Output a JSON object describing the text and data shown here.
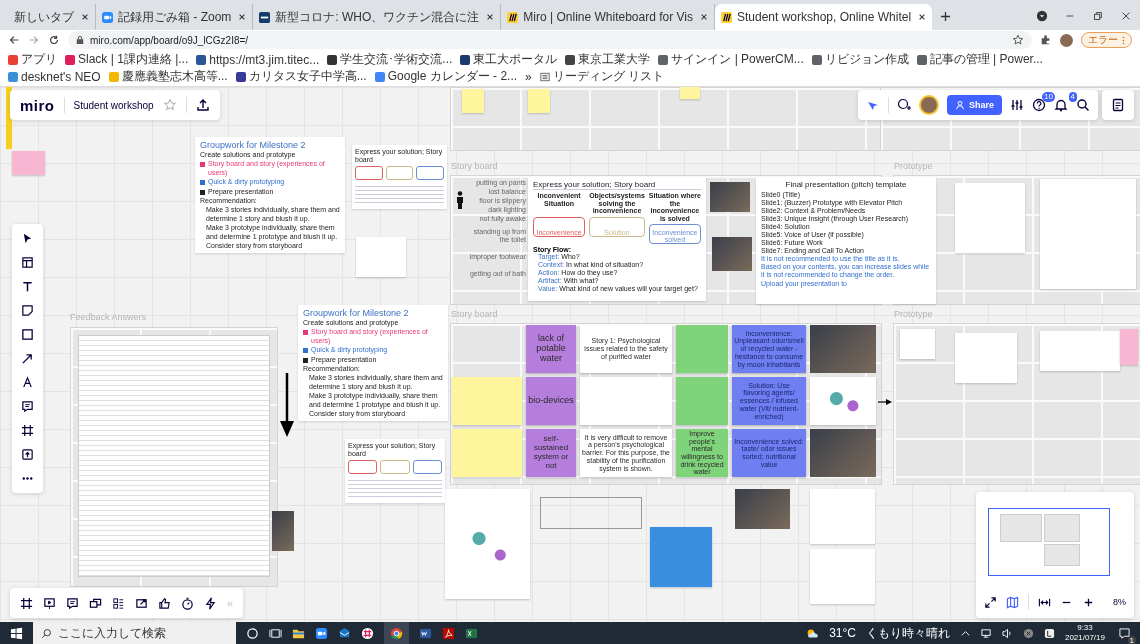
{
  "browser": {
    "tabs": [
      {
        "title": "新しいタブ",
        "selected": false,
        "kind": "blank"
      },
      {
        "title": "記録用ごみ箱 - Zoom",
        "selected": false,
        "kind": "zoom"
      },
      {
        "title": "新型コロナ: WHO、ワクチン混合に注",
        "selected": false,
        "kind": "news"
      },
      {
        "title": "Miro | Online Whiteboard for Vis",
        "selected": false,
        "kind": "miro"
      },
      {
        "title": "Student workshop, Online Whitel",
        "selected": true,
        "kind": "miro"
      }
    ],
    "url": "miro.com/app/board/o9J_lCGz2I8=/",
    "profile_button": "エラー",
    "bookmarks": [
      {
        "label": "アプリ",
        "color": "#e94235"
      },
      {
        "label": "Slack | 1課内連絡 |...",
        "color": "#e01e5a"
      },
      {
        "label": "https://mt3.jim.titec...",
        "color": "#2b5797"
      },
      {
        "label": "学生交流･学術交流...",
        "color": "#333333"
      },
      {
        "label": "東工大ポータル",
        "color": "#1a3a6b"
      },
      {
        "label": "東京工業大学",
        "color": "#444444"
      },
      {
        "label": "サインイン | PowerCM...",
        "color": "#5f6368"
      },
      {
        "label": "リビジョン作成",
        "color": "#5f6368"
      },
      {
        "label": "記事の管理 | Power...",
        "color": "#5f6368"
      },
      {
        "label": "desknet's NEO",
        "color": "#3a8fd8"
      },
      {
        "label": "慶應義塾志木高等...",
        "color": "#f2b705"
      },
      {
        "label": "カリタス女子中学高...",
        "color": "#3a3a9a"
      },
      {
        "label": "Google カレンダー - 2...",
        "color": "#4285f4"
      }
    ],
    "more_bookmarks": "»",
    "reading_list": "リーディング リスト"
  },
  "miro": {
    "logo": "miro",
    "board_name": "Student workshop",
    "share_label": "Share",
    "help_badge": "10",
    "notification_badge": "4",
    "collapse": "«",
    "zoom_level": "8%"
  },
  "board": {
    "frames": [
      {
        "title": "Story board"
      },
      {
        "title": "Prototype"
      },
      {
        "title": "Feedback Answers"
      },
      {
        "title": "Story board"
      },
      {
        "title": "Prototype"
      }
    ],
    "groupwork_cards": [
      {
        "title": "Groupwork for Milestone 2",
        "subtitle": "Create solutions and prototype",
        "items": [
          {
            "text": "Story board and story (experiences of users)",
            "color": "#e8367a"
          },
          {
            "text": "Quick & dirty prototyping",
            "color": "#2f6fd0"
          },
          {
            "text": "Prepare presentation",
            "color": "#222222"
          }
        ],
        "recommendation_label": "Recommendation:",
        "recommendations": [
          "Make 3 stories individually, share them and determine 1 story and blush it up.",
          "Make 3 prototype individually, share them and determine 1 prototype and blush it up.",
          "Consider story from storyboard"
        ]
      },
      {
        "title": "Groupwork for Milestone 2",
        "subtitle": "Create solutions and prototype",
        "items": [
          {
            "text": "Story board and story (experiences of users)",
            "color": "#e8367a"
          },
          {
            "text": "Quick & dirty prototyping",
            "color": "#2f6fd0"
          },
          {
            "text": "Prepare presentation",
            "color": "#222222"
          }
        ],
        "recommendation_label": "Recommendation:",
        "recommendations": [
          "Make 3 stories individually, share them and determine 1 story and blush it up.",
          "Make 3 prototype individually, share them and determine 1 prototype and blush it up.",
          "Consider story from storyboard"
        ]
      }
    ],
    "storyboard_thumbnails": [
      {
        "title": "Express your solution; Story board"
      },
      {
        "title": "Express your solution; Story board"
      }
    ],
    "storyboard_notes": [
      "putting on pants",
      "lost balance",
      "floor is slippery",
      "dark lighting",
      "not fully awake",
      "standing up from the toilet",
      "improper footwear",
      "getting out of bath"
    ],
    "storyboard_card": {
      "title": "Express your solution; Story board",
      "columns": [
        {
          "heading": "Inconvenient Situation",
          "caption": "Inconvenience",
          "color": "#e06060"
        },
        {
          "heading": "Objects/systems solving the inconvenience",
          "caption": "Solution",
          "color": "#c8b88a"
        },
        {
          "heading": "Situation where the inconvenience is solved",
          "caption": "Inconvenience solved",
          "color": "#6a8fd0"
        }
      ],
      "flow_label": "Story Flow:",
      "flow": [
        {
          "label": "Target:",
          "text": "Who?"
        },
        {
          "label": "Context:",
          "text": "In what kind of situation?"
        },
        {
          "label": "Action:",
          "text": "How do they use?"
        },
        {
          "label": "Artifact:",
          "text": "With what?"
        },
        {
          "label": "Value:",
          "text": "What kind of new values will your target get?"
        }
      ]
    },
    "pitch_template": {
      "title": "Final presentation (pitch) template",
      "slides": [
        "Slide0 (Title)",
        "Slide1: (Buzzer) Prototype with Elevator Pitch",
        "Slide2: Context & Problem/Needs",
        "Slide3: Unique Insight (through User Research)",
        "Slide4: Solution",
        "Slide5: Voice of User (if possible)",
        "Slide6: Future Work",
        "Slide7: Ending and Call To Action"
      ],
      "notes": [
        "It is not recommended to use the title as it is.",
        "Based on your contents, you can increase slides while it is not recommended to change the order.",
        "Upload your presentation to"
      ]
    },
    "stickies": [
      {
        "text": "lack of potable water",
        "color": "#b57edc"
      },
      {
        "text": "bio-devices",
        "color": "#b57edc"
      },
      {
        "text": "self-sustained system or not",
        "color": "#b57edc"
      },
      {
        "text": "Story 1: Psychological issues related to the safety of purified water",
        "color": "#ffffff"
      },
      {
        "text": "It is very difficult to remove a person's psychological barrier. For this purpose, the stability of the purification system is shown.",
        "color": "#ffffff"
      },
      {
        "text": "Improve people's mental willingness to drink recycled water",
        "color": "#7fd37a"
      },
      {
        "text": "Inconvenience: Unpleasant odor/smell of recycled water - hesitance to consume by moon inhabitants",
        "color": "#6f7ff2"
      },
      {
        "text": "Solution: Use flavoring agents/ essences / infused water (Vit/ nutrient-enriched)",
        "color": "#6f7ff2"
      },
      {
        "text": "Inconvenience solved: taste/ odor issues sorted; nutritional value",
        "color": "#6f7ff2"
      }
    ]
  },
  "taskbar": {
    "search_placeholder": "ここに入力して検索",
    "temperature": "31°C",
    "weather": "くもり時々晴れ",
    "time": "9:33",
    "date": "2021/07/19",
    "notification_count": "1"
  }
}
